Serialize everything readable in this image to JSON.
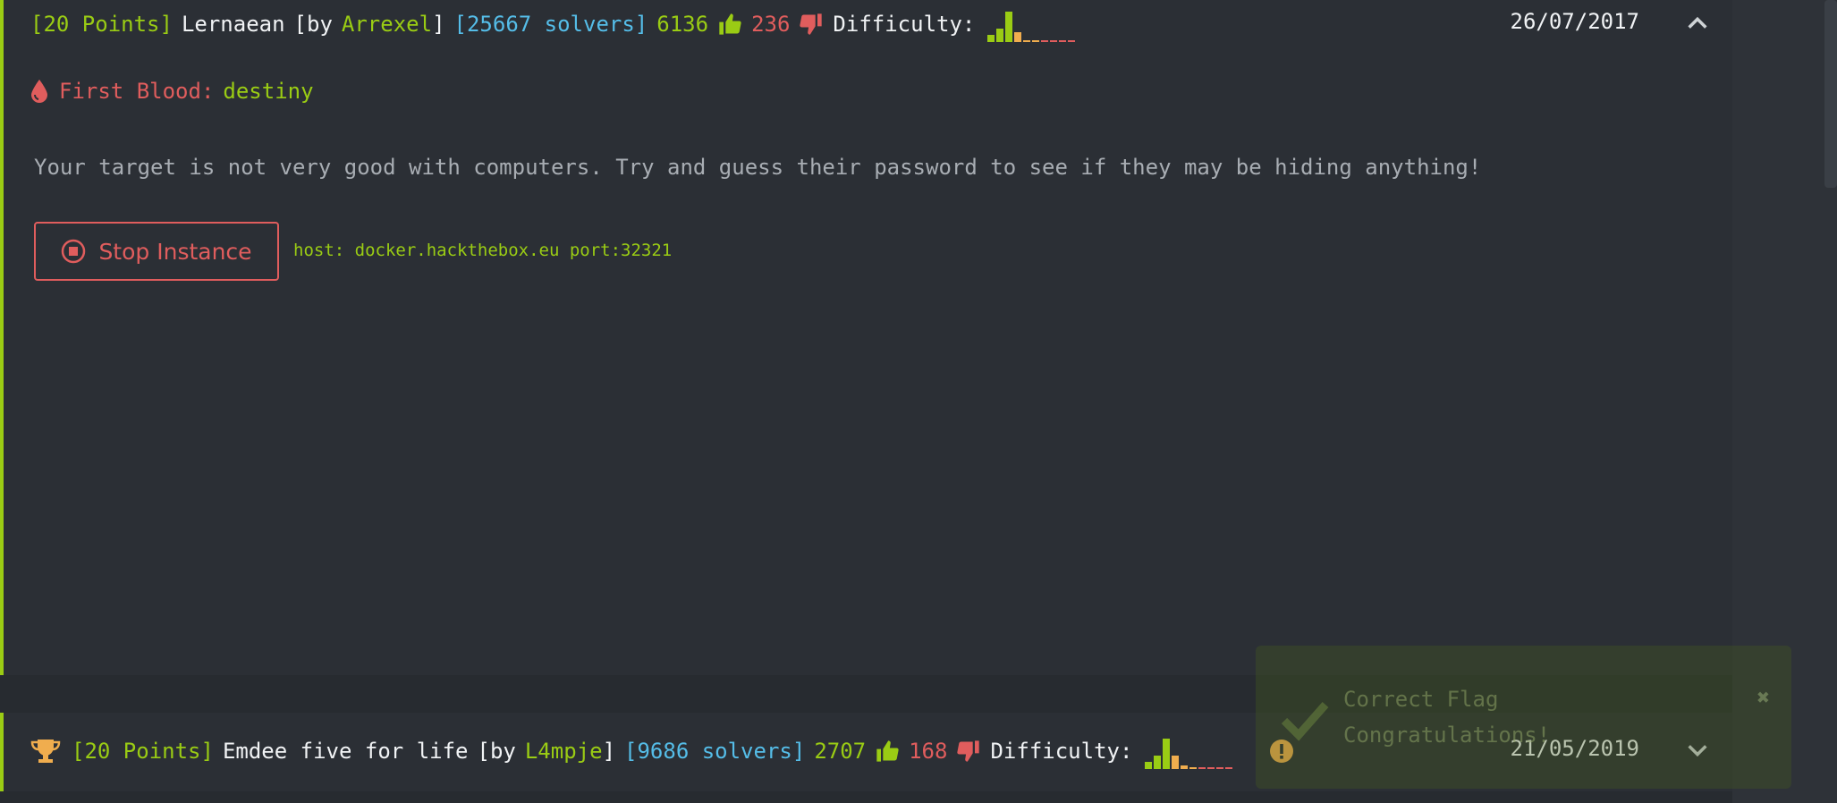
{
  "challenge1": {
    "points": "[20 Points]",
    "name": "Lernaean",
    "by_prefix": "[by",
    "author": "Arrexel",
    "by_suffix": "]",
    "solvers": "[25667 solvers]",
    "likes": "6136",
    "dislikes": "236",
    "difficulty_label": "Difficulty:",
    "date": "26/07/2017",
    "first_blood_label": "First Blood:",
    "first_blood_user": "destiny",
    "description": "Your target is not very good with computers. Try and guess their password to see if they may be hiding anything!",
    "stop_button": "Stop Instance",
    "host_info": "host: docker.hackthebox.eu port:32321",
    "difficulty_levels": [
      0.2,
      0.4,
      0.9,
      0.3,
      0.05,
      0.05,
      0.0,
      0.0,
      0.0,
      0.0
    ]
  },
  "challenge2": {
    "points": "[20 Points]",
    "name": "Emdee five for life",
    "by_prefix": "[by",
    "author": "L4mpje",
    "by_suffix": "]",
    "solvers": "[9686 solvers]",
    "likes": "2707",
    "dislikes": "168",
    "difficulty_label": "Difficulty:",
    "date": "21/05/2019",
    "difficulty_levels": [
      0.2,
      0.4,
      0.9,
      0.4,
      0.1,
      0.05,
      0.0,
      0.0,
      0.0,
      0.0
    ]
  },
  "toast": {
    "title": "Correct Flag",
    "message": "Congratulations!",
    "close": "✖"
  },
  "colors": {
    "accent_green": "#9acc14",
    "blue": "#55bde8",
    "red": "#e05d5d",
    "orange": "#f0ad4e"
  },
  "icons": {
    "like": "thumbs-up-icon",
    "dislike": "thumbs-down-icon",
    "collapse": "chevron-up-icon",
    "expand": "chevron-down-icon",
    "first_blood": "blood-drop-icon",
    "stop": "stop-circle-icon",
    "solved": "trophy-icon",
    "warning": "exclamation-circle-icon",
    "toast_check": "checkmark-icon",
    "toast_close": "close-icon"
  }
}
